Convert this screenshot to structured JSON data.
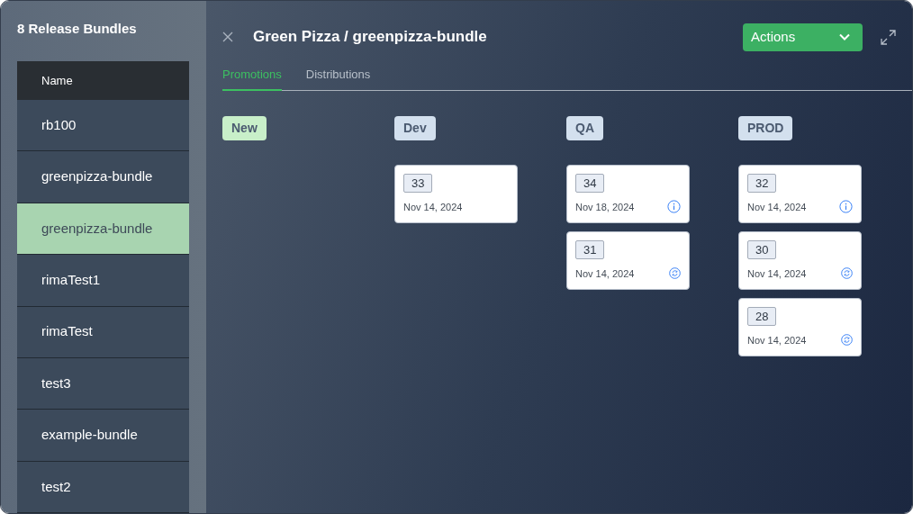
{
  "sidebar": {
    "title": "8 Release Bundles",
    "column_header": "Name",
    "items": [
      {
        "label": "rb100",
        "selected": false
      },
      {
        "label": "greenpizza-bundle",
        "selected": false
      },
      {
        "label": "greenpizza-bundle",
        "selected": true
      },
      {
        "label": "rimaTest1",
        "selected": false
      },
      {
        "label": "rimaTest",
        "selected": false
      },
      {
        "label": "test3",
        "selected": false
      },
      {
        "label": "example-bundle",
        "selected": false
      },
      {
        "label": "test2",
        "selected": false
      }
    ]
  },
  "panel": {
    "title": "Green Pizza / greenpizza-bundle",
    "actions_button": "Actions",
    "tabs": [
      {
        "label": "Promotions",
        "selected": true
      },
      {
        "label": "Distributions",
        "selected": false
      }
    ],
    "stages": [
      {
        "label": "New",
        "color": "#c8efc9"
      },
      {
        "label": "Dev",
        "color": "#d3e0ee",
        "cards": [
          {
            "version": "33",
            "date": "Nov 14, 2024"
          }
        ]
      },
      {
        "label": "QA",
        "color": "#d3e0ee",
        "cards": [
          {
            "version": "34",
            "date": "Nov 18, 2024",
            "kind": "info"
          },
          {
            "version": "31",
            "date": "Nov 14, 2024",
            "kind": "sync"
          }
        ]
      },
      {
        "label": "PROD",
        "color": "#d3e0ee",
        "cards": [
          {
            "version": "32",
            "date": "Nov 14, 2024",
            "kind": "info"
          },
          {
            "version": "30",
            "date": "Nov 14, 2024",
            "kind": "sync"
          },
          {
            "version": "28",
            "date": "Nov 14, 2024",
            "kind": "sync"
          }
        ]
      }
    ]
  }
}
